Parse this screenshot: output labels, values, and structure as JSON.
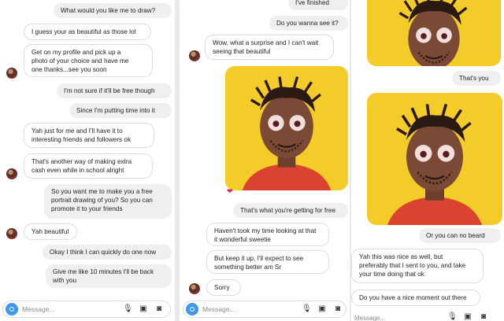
{
  "panel1": {
    "messages": [
      {
        "text": "What would you like me to draw?"
      },
      {
        "text": "I guess your as beautiful as those lol"
      },
      {
        "text": "Get on my profile and pick up a\nphoto of your choice and have me\none thanks...see you soon"
      },
      {
        "text": "I'm not sure if it'll be free though"
      },
      {
        "text": "Since I'm putting time into it"
      },
      {
        "text": "Yah just for me and I'll have it to\ninteresting friends and followers ok"
      },
      {
        "text": "That's another way of making extra\ncash even while in school alright"
      },
      {
        "text": "So you want me to make you a free\nportrait drawing of you? So you can\npromote it to your friends"
      },
      {
        "text": "Yah beautiful"
      },
      {
        "text": "Okay I think I can quickly do one now"
      },
      {
        "text": "Give me like 10 minutes I'll be back\nwith you"
      }
    ],
    "input_placeholder": "Message..."
  },
  "panel2": {
    "messages": [
      {
        "text": "I've finished"
      },
      {
        "text": "Do you wanna see it?"
      },
      {
        "text": "Wow, what a surprise and I can't wait\nseeing that beautiful"
      },
      {
        "text": "That's what you're getting for free"
      },
      {
        "text": "Haven't took my time looking at that\nit wonderful sweetie"
      },
      {
        "text": "But keep it up, I'll expect to see\nsomething better am Sr"
      },
      {
        "text": "Sorry"
      }
    ],
    "reaction": "❤",
    "input_placeholder": "Message..."
  },
  "panel3": {
    "messages": [
      {
        "text": "That's you"
      },
      {
        "text": "Or you can no beard"
      },
      {
        "text": "Yah this was nice as well, but\npreferably that I sent to you, and take\nyour time doing that ok"
      },
      {
        "text": "Do you have a nice moment out there"
      }
    ],
    "input_placeholder": "Message..."
  },
  "colors": {
    "portrait_bg": "#f4cc2a",
    "skin": "#7a4a36",
    "shirt": "#d9432f",
    "camera": "#3f97f0"
  },
  "icons": [
    "camera-icon",
    "microphone-icon",
    "gallery-icon",
    "sticker-icon",
    "heart-reaction-icon"
  ]
}
